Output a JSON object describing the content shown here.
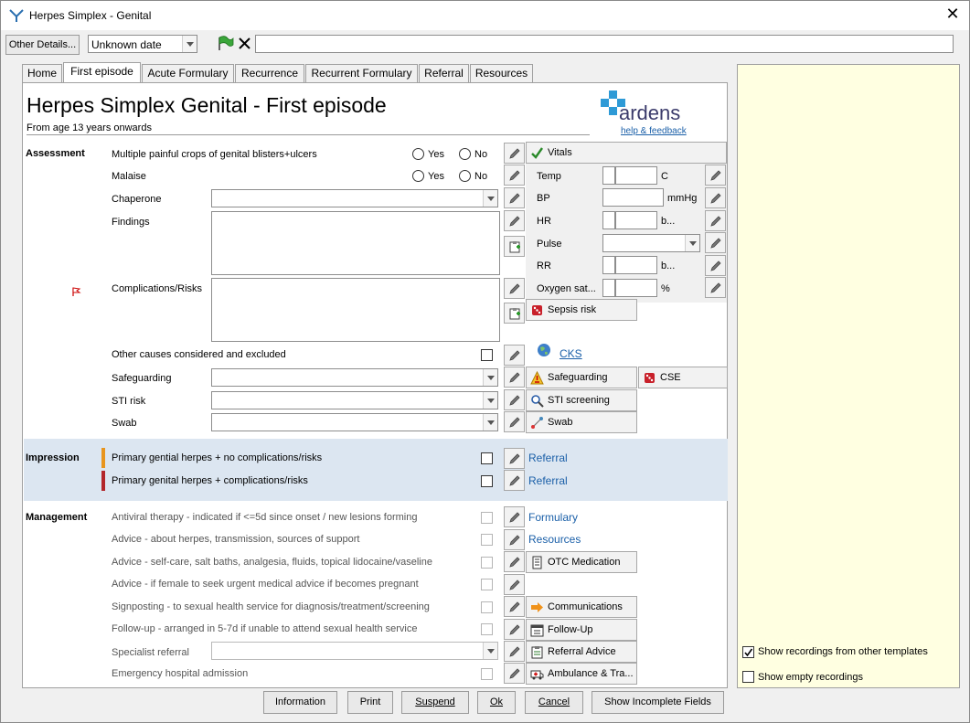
{
  "window": {
    "title": "Herpes Simplex - Genital"
  },
  "toolbar": {
    "other_details": "Other Details...",
    "date_value": "Unknown date"
  },
  "tabs": [
    "Home",
    "First episode",
    "Acute Formulary",
    "Recurrence",
    "Recurrent Formulary",
    "Referral",
    "Resources"
  ],
  "header": {
    "title": "Herpes Simplex Genital - First episode",
    "subtitle": "From age 13 years onwards",
    "brand": "ardens",
    "help": "help & feedback"
  },
  "assessment": {
    "section": "Assessment",
    "blisters": "Multiple painful crops of genital blisters+ulcers",
    "malaise": "Malaise",
    "yes": "Yes",
    "no": "No",
    "chaperone": "Chaperone",
    "findings": "Findings",
    "complications": "Complications/Risks",
    "other_causes": "Other causes considered and excluded",
    "safeguarding": "Safeguarding",
    "sti_risk": "STI risk",
    "swab": "Swab"
  },
  "vitals": {
    "title": "Vitals",
    "temp": "Temp",
    "temp_unit": "C",
    "bp": "BP",
    "bp_unit": "mmHg",
    "hr": "HR",
    "hr_unit": "b...",
    "pulse": "Pulse",
    "rr": "RR",
    "rr_unit": "b...",
    "oxygen": "Oxygen sat...",
    "oxygen_unit": "%"
  },
  "buttons": {
    "sepsis": "Sepsis risk",
    "cks": "CKS",
    "safeguarding": "Safeguarding",
    "cse": "CSE",
    "sti_screening": "STI screening",
    "swab": "Swab",
    "otc": "OTC Medication",
    "communications": "Communications",
    "followup": "Follow-Up",
    "referral_advice": "Referral Advice",
    "ambulance": "Ambulance & Tra..."
  },
  "impression": {
    "section": "Impression",
    "item1": "Primary gential herpes + no complications/risks",
    "item2": "Primary genital herpes + complications/risks",
    "referral": "Referral"
  },
  "management": {
    "section": "Management",
    "antiviral": "Antiviral therapy - indicated if <=5d since onset / new lesions forming",
    "advice1": "Advice - about herpes, transmission, sources of support",
    "advice2": "Advice - self-care, salt baths, analgesia, fluids, topical lidocaine/vaseline",
    "advice3": "Advice - if female to seek urgent medical advice if becomes pregnant",
    "signposting": "Signposting - to sexual health service for diagnosis/treatment/screening",
    "followup": "Follow-up - arranged in 5-7d if unable to attend sexual health service",
    "specialist": "Specialist referral",
    "emergency": "Emergency hospital admission",
    "formulary": "Formulary",
    "resources": "Resources"
  },
  "sidepanel": {
    "show_other": "Show recordings from other templates",
    "show_empty": "Show empty recordings"
  },
  "footer": {
    "information": "Information",
    "print": "Print",
    "suspend": "Suspend",
    "ok": "Ok",
    "cancel": "Cancel",
    "incomplete": "Show Incomplete Fields"
  },
  "colors": {
    "impression_band": "#dce6f1",
    "side_panel": "#ffffe1",
    "link": "#1a5fa8",
    "marker_orange": "#e8951e",
    "marker_red": "#b3262b"
  }
}
